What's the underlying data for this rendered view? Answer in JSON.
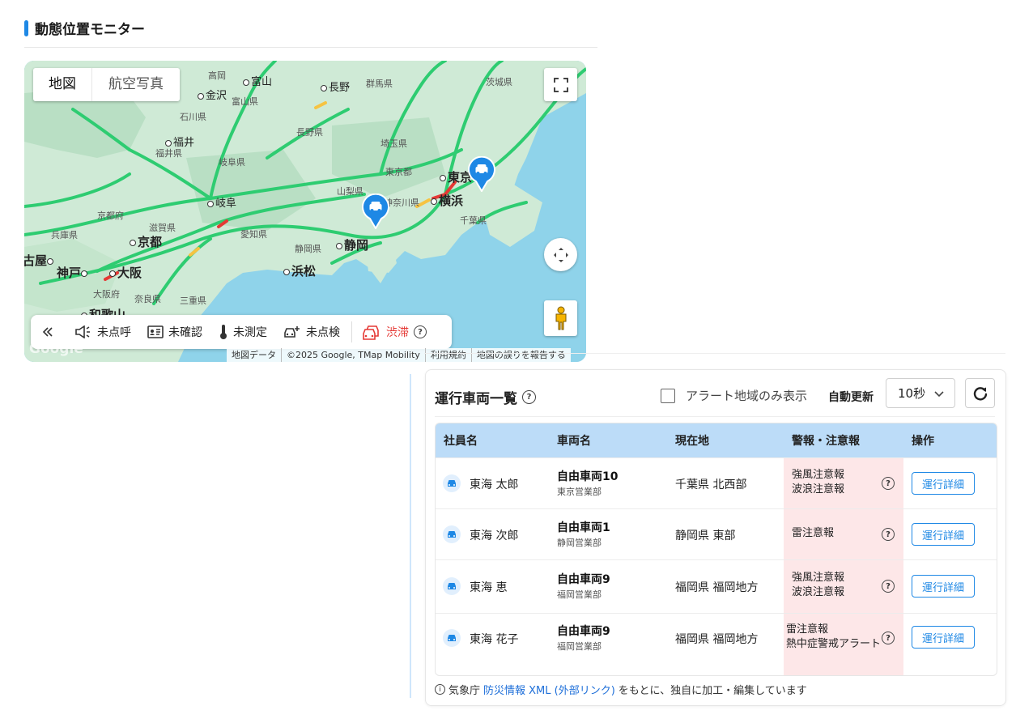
{
  "page": {
    "title": "動態位置モニター"
  },
  "map": {
    "type_buttons": [
      "地図",
      "航空写真"
    ],
    "labels": [
      {
        "text": "高岡",
        "kind": "small"
      },
      {
        "text": "富山",
        "kind": "small"
      },
      {
        "text": "長野",
        "kind": "small"
      },
      {
        "text": "群馬県",
        "kind": "area"
      },
      {
        "text": "茨城県",
        "kind": "area"
      },
      {
        "text": "金沢",
        "kind": "small"
      },
      {
        "text": "富山県",
        "kind": "area"
      },
      {
        "text": "石川県",
        "kind": "area"
      },
      {
        "text": "長野県",
        "kind": "area"
      },
      {
        "text": "福井",
        "kind": "small"
      },
      {
        "text": "福井県",
        "kind": "area"
      },
      {
        "text": "埼玉県",
        "kind": "area"
      },
      {
        "text": "岐阜県",
        "kind": "area"
      },
      {
        "text": "東京都",
        "kind": "area"
      },
      {
        "text": "東京",
        "kind": "city"
      },
      {
        "text": "山梨県",
        "kind": "area"
      },
      {
        "text": "岐阜",
        "kind": "small"
      },
      {
        "text": "神奈川県",
        "kind": "area"
      },
      {
        "text": "横浜",
        "kind": "city"
      },
      {
        "text": "京都府",
        "kind": "area"
      },
      {
        "text": "千葉県",
        "kind": "area"
      },
      {
        "text": "滋賀県",
        "kind": "area"
      },
      {
        "text": "兵庫県",
        "kind": "area"
      },
      {
        "text": "愛知県",
        "kind": "area"
      },
      {
        "text": "京都",
        "kind": "city"
      },
      {
        "text": "静岡県",
        "kind": "area"
      },
      {
        "text": "静岡",
        "kind": "city"
      },
      {
        "text": "古屋",
        "kind": "city"
      },
      {
        "text": "神戸",
        "kind": "city"
      },
      {
        "text": "大阪",
        "kind": "city"
      },
      {
        "text": "浜松",
        "kind": "city"
      },
      {
        "text": "大阪府",
        "kind": "area"
      },
      {
        "text": "奈良県",
        "kind": "area"
      },
      {
        "text": "三重県",
        "kind": "area"
      },
      {
        "text": "和歌山",
        "kind": "city"
      }
    ],
    "legend": {
      "items": [
        "未点呼",
        "未確認",
        "未測定",
        "未点検"
      ],
      "traffic": "渋滞",
      "traffic_color": "#e53935"
    },
    "attribution": [
      "地図データ",
      "©2025 Google, TMap Mobility",
      "利用規約",
      "地図の誤りを報告する"
    ],
    "logo": "Google",
    "pin_color": "#1e88e5",
    "road_color": "#2ecc71",
    "land_color": "#cfead6",
    "sea_color": "#8fd3ea"
  },
  "panel": {
    "title": "運行車両一覧",
    "alert_only_label": "アラート地域のみ表示",
    "auto_refresh_label": "自動更新",
    "refresh_interval": "10秒",
    "columns": [
      "社員名",
      "車両名",
      "現在地",
      "警報・注意報",
      "操作"
    ],
    "rows": [
      {
        "employee": "東海 太郎",
        "vehicle": "自由車両10",
        "office": "東京営業部",
        "location": "千葉県 北西部",
        "warnings": [
          "強風注意報",
          "波浪注意報"
        ],
        "action": "運行詳細"
      },
      {
        "employee": "東海 次郎",
        "vehicle": "自由車両1",
        "office": "静岡営業部",
        "location": "静岡県 東部",
        "warnings": [
          "雷注意報"
        ],
        "action": "運行詳細"
      },
      {
        "employee": "東海 恵",
        "vehicle": "自由車両9",
        "office": "福岡営業部",
        "location": "福岡県 福岡地方",
        "warnings": [
          "強風注意報",
          "波浪注意報"
        ],
        "action": "運行詳細"
      },
      {
        "employee": "東海 花子",
        "vehicle": "自由車両9",
        "office": "福岡営業部",
        "location": "福岡県 福岡地方",
        "warnings": [
          "雷注意報",
          "熱中症警戒アラート"
        ],
        "action": "運行詳細"
      }
    ],
    "footnote": {
      "prefix": "気象庁",
      "link": "防災情報 XML (外部リンク)",
      "suffix": "をもとに、独自に加工・編集しています"
    },
    "accent_color": "#1e88e5",
    "header_color": "#bcdcf8",
    "alert_bg": "#fde7e8"
  }
}
